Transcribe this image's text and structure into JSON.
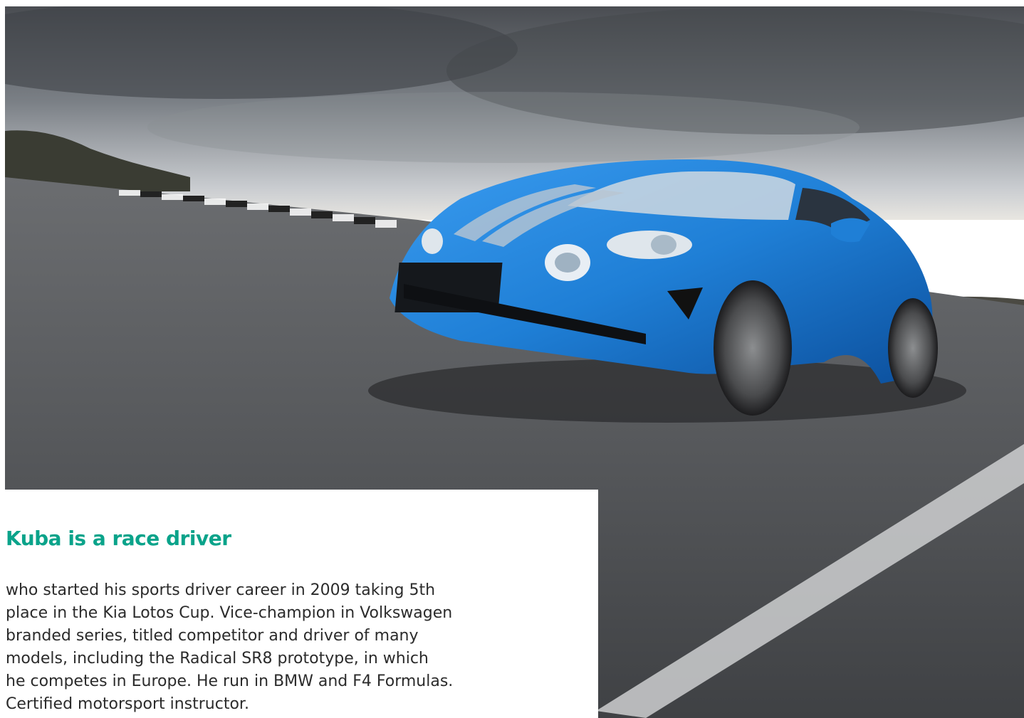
{
  "hero": {
    "image": "blue-alpine-sports-car-on-race-track"
  },
  "card": {
    "title": "Kuba is a race driver",
    "lines": [
      "who started his sports driver career in 2009 taking 5th",
      "place in the Kia Lotos Cup. Vice-champion in Volkswagen",
      "branded series, titled competitor and driver of many",
      "models, including the Radical SR8 prototype, in which",
      "he competes in Europe. He run in BMW and F4 Formulas.",
      "Certified motorsport instructor."
    ]
  },
  "colors": {
    "accent": "#0aa38a",
    "car_blue": "#1f7fd6",
    "text": "#2b2b2b"
  }
}
